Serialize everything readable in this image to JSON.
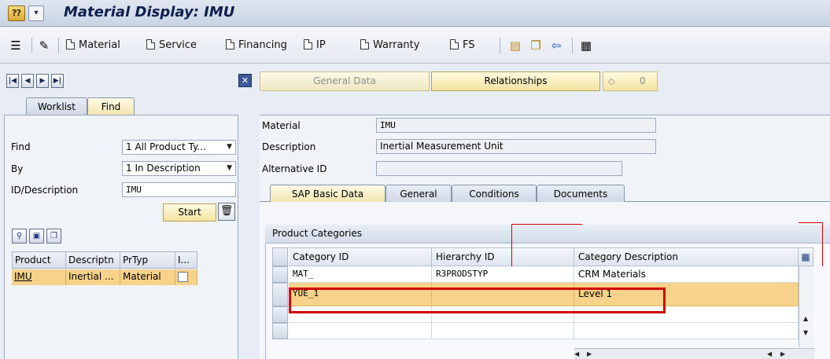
{
  "title": {
    "icon_glyph": "⁇",
    "menu_glyph": "▾",
    "text": "Material Display: IMU"
  },
  "toolbar": {
    "material_label": "Material",
    "service_label": "Service",
    "financing_label": "Financing",
    "ip_label": "IP",
    "warranty_label": "Warranty",
    "fs_label": "FS"
  },
  "nav": {
    "general_data_label": "General Data",
    "relationships_label": "Relationships",
    "counter_value": "0",
    "close_glyph": "✕"
  },
  "left_tabs": {
    "worklist": "Worklist",
    "find": "Find"
  },
  "search": {
    "find_label": "Find",
    "find_value": "1 All Product Ty...",
    "by_label": "By",
    "by_value": "1 In Description",
    "id_desc_label": "ID/Description",
    "id_desc_value": "IMU",
    "start_label": "Start"
  },
  "results": {
    "columns": [
      "Product",
      "Descriptn",
      "PrTyp",
      "I..."
    ],
    "row": {
      "product": "IMU",
      "description": "Inertial ...",
      "prtyp": "Material"
    }
  },
  "header": {
    "material_label": "Material",
    "material_value": "IMU",
    "description_label": "Description",
    "description_value": "Inertial Measurement Unit",
    "alt_id_label": "Alternative ID",
    "alt_id_value": ""
  },
  "detail_tabs": [
    "SAP Basic Data",
    "General",
    "Conditions",
    "Documents"
  ],
  "product_categories": {
    "title": "Product Categories",
    "columns": [
      "Category ID",
      "Hierarchy ID",
      "Category Description"
    ],
    "rows": [
      {
        "category_id": "MAT_",
        "hierarchy_id": "R3PRODSTYP",
        "category_description": "CRM Materials"
      },
      {
        "category_id": "YUE_1",
        "hierarchy_id": "",
        "category_description": "Level 1"
      }
    ]
  },
  "colors": {
    "highlight": "#f6d28a",
    "annotation_red": "#d00000",
    "title_blue": "#0d1f4d"
  }
}
